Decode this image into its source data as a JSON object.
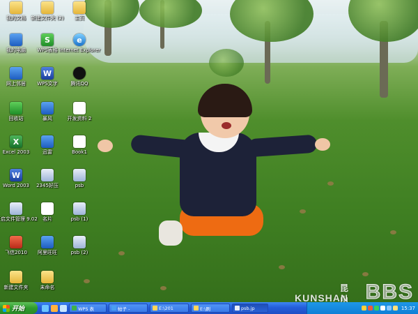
{
  "desktop": {
    "icons": [
      {
        "label": "我的文档",
        "icon": "folder-icon",
        "glyph": ""
      },
      {
        "label": "我的电脑",
        "icon": "computer-icon",
        "glyph": ""
      },
      {
        "label": "网上邻居",
        "icon": "network-icon",
        "glyph": ""
      },
      {
        "label": "回收站",
        "icon": "recycle-bin-icon",
        "glyph": ""
      },
      {
        "label": "Excel 2003",
        "icon": "excel-icon",
        "glyph": "X"
      },
      {
        "label": "Word 2003",
        "icon": "word-icon",
        "glyph": "W"
      },
      {
        "label": "开启文件管理 9.02",
        "icon": "file-manager-icon",
        "glyph": ""
      },
      {
        "label": "飞信2010",
        "icon": "fetion-icon",
        "glyph": ""
      },
      {
        "label": "新建文件夹",
        "icon": "folder-icon",
        "glyph": ""
      },
      {
        "label": "新建文件夹 (2)",
        "icon": "folder-icon",
        "glyph": ""
      },
      {
        "label": "WPS表格",
        "icon": "wps-spreadsheet-icon",
        "glyph": "S"
      },
      {
        "label": "WPS文字",
        "icon": "wps-writer-icon",
        "glyph": "W"
      },
      {
        "label": "暴风",
        "icon": "player-icon",
        "glyph": ""
      },
      {
        "label": "迅雷",
        "icon": "thunder-icon",
        "glyph": ""
      },
      {
        "label": "2345好压",
        "icon": "haozip-icon",
        "glyph": ""
      },
      {
        "label": "名片",
        "icon": "document-icon",
        "glyph": ""
      },
      {
        "label": "阿里旺旺",
        "icon": "aliwangwang-icon",
        "glyph": ""
      },
      {
        "label": "未命名",
        "icon": "folder-icon",
        "glyph": ""
      },
      {
        "label": "主页",
        "icon": "folder-icon",
        "glyph": ""
      },
      {
        "label": "Internet Explorer",
        "icon": "ie-icon",
        "glyph": "e"
      },
      {
        "label": "腾讯QQ",
        "icon": "qq-icon",
        "glyph": ""
      },
      {
        "label": "开发资料 2",
        "icon": "document-icon",
        "glyph": ""
      },
      {
        "label": "Book1",
        "icon": "document-icon",
        "glyph": ""
      },
      {
        "label": "psb",
        "icon": "image-icon",
        "glyph": ""
      },
      {
        "label": "psb (1)",
        "icon": "image-icon",
        "glyph": ""
      },
      {
        "label": "psb (2)",
        "icon": "image-icon",
        "glyph": ""
      }
    ]
  },
  "watermark": {
    "chinese": "昆山论坛",
    "english": "KUNSHAN",
    "bbs": "BBS"
  },
  "taskbar": {
    "start_label": "开始",
    "tasks": [
      {
        "label": "WPS 表"
      },
      {
        "label": "帖子 -"
      },
      {
        "label": "E:\\201"
      },
      {
        "label": "E:\\刷"
      },
      {
        "label": "psb.jp"
      }
    ],
    "clock": "15:37"
  }
}
